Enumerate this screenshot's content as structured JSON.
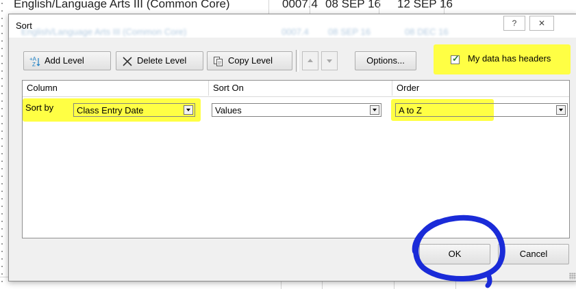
{
  "background": {
    "row_text": [
      "English/Language Arts III (Common Core)",
      "0007.4",
      "08 SEP 16",
      "12 SEP 16"
    ],
    "blurred_row": [
      "English/Language Arts III (Common Core)",
      "0007.4",
      "08 SEP 16",
      "08 DEC 16"
    ]
  },
  "dialog": {
    "title": "Sort",
    "help_label": "?",
    "close_label": "✕",
    "toolbar": {
      "add_level": "Add Level",
      "delete_level": "Delete Level",
      "copy_level": "Copy Level",
      "options": "Options...",
      "headers_checkbox_label": "My data has headers",
      "headers_checked": true
    },
    "columns": [
      "Column",
      "Sort On",
      "Order"
    ],
    "row": {
      "prefix": "Sort by",
      "column": "Class Entry Date",
      "sort_on": "Values",
      "order": "A to Z"
    },
    "ok_label": "OK",
    "cancel_label": "Cancel"
  },
  "colors": {
    "highlight": "#ffff44",
    "annotation_circle": "#1a2bd8"
  },
  "icons": {
    "add": "add-level-icon",
    "delete": "delete-x-icon",
    "copy": "copy-icon",
    "up": "move-up-icon",
    "down": "move-down-icon"
  }
}
